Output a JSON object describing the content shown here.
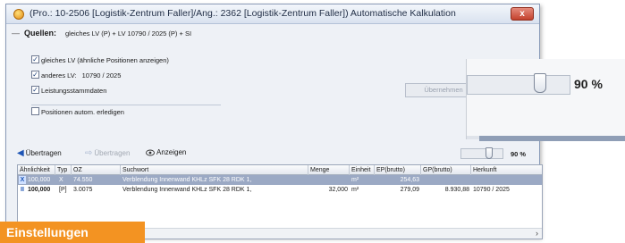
{
  "window": {
    "title": "(Pro.: 10-2506 [Logistik-Zentrum Faller]/Ang.: 2362 [Logistik-Zentrum Faller]) Automatische Kalkulation",
    "close_label": "x"
  },
  "sources": {
    "label": "Quellen:",
    "summary": "gleiches LV (P) + LV 10790 / 2025 (P) + SI",
    "options": [
      {
        "label": "gleiches LV (ähnliche Positionen anzeigen)",
        "checked": true,
        "value": ""
      },
      {
        "label": "anderes LV:",
        "checked": true,
        "value": "10790 / 2025"
      },
      {
        "label": "Leistungsstammdaten",
        "checked": true,
        "value": ""
      },
      {
        "label": "Positionen autom. erledigen",
        "checked": false,
        "value": ""
      }
    ],
    "apply_label": "Übernehmen"
  },
  "zoom": {
    "text": "90 %",
    "level_percent": 90
  },
  "toolbar": {
    "transfer_label": "Übertragen",
    "transfer_disabled_label": "Übertragen",
    "show_label": "Anzeigen",
    "zoom_text": "90 %"
  },
  "grid": {
    "headers": [
      "Ähnlichkeit",
      "Typ",
      "OZ",
      "Suchwort",
      "Menge",
      "Einheit",
      "EP(brutto)",
      "GP(brutto)",
      "Herkunft"
    ],
    "rows": [
      {
        "icon": "X",
        "similarity": "100,000",
        "type": "X",
        "oz": "74.550",
        "keyword": "Verblendung Innenwand KHLz SFK 28 RDK 1,",
        "quantity": "",
        "unit": "m²",
        "ep": "254,63",
        "gp": "",
        "origin": "",
        "selected": true
      },
      {
        "icon": "II",
        "similarity": "100,000",
        "type": "[P]",
        "oz": "3.0075",
        "keyword": "Verblendung Innenwand KHLz SFK 28 RDK 1,",
        "quantity": "32,000",
        "unit": "m²",
        "ep": "279,09",
        "gp": "8.930,88",
        "origin": "10790 / 2025",
        "selected": false
      }
    ]
  },
  "banner": {
    "text": "Einstellungen"
  }
}
